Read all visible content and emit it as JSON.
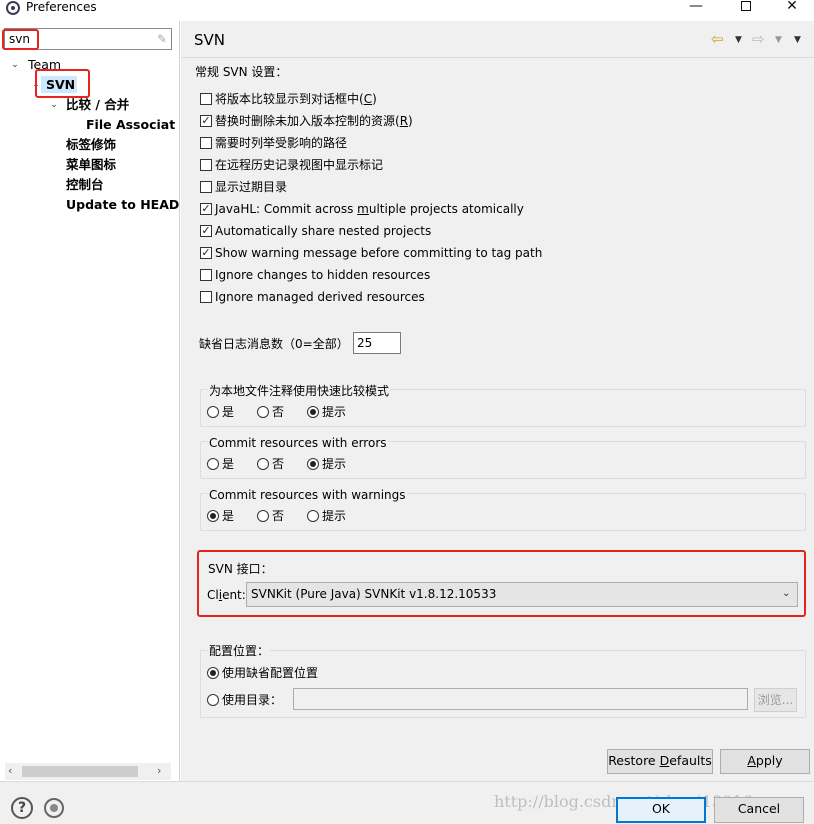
{
  "window": {
    "title": "Preferences",
    "minimize": "—",
    "close": "✕"
  },
  "filter": {
    "value": "svn",
    "clear_icon": "eraser-icon"
  },
  "tree": {
    "team": "Team",
    "svn": "SVN",
    "compare_merge": "比较 / 合并",
    "file_assoc": "File Associatio",
    "label_decorations": "标签修饰",
    "menu_icons": "菜单图标",
    "console": "控制台",
    "update_head": "Update to HEAD"
  },
  "header": {
    "title": "SVN",
    "back_icon": "back-arrow-icon",
    "forward_icon": "forward-arrow-icon"
  },
  "general": {
    "heading": "常规 SVN 设置：",
    "options": [
      {
        "label_a": "将版本比较显示到对话框中(",
        "key": "C",
        "label_b": ")",
        "checked": false
      },
      {
        "label_a": "替换时删除未加入版本控制的资源(",
        "key": "R",
        "label_b": ")",
        "checked": true
      },
      {
        "label_a": "需要时列举受影响的路径",
        "key": "",
        "label_b": "",
        "checked": false
      },
      {
        "label_a": "在远程历史记录视图中显示标记",
        "key": "",
        "label_b": "",
        "checked": false
      },
      {
        "label_a": "显示过期目录",
        "key": "",
        "label_b": "",
        "checked": false
      },
      {
        "label_a": "JavaHL: Commit across ",
        "key": "m",
        "label_b": "ultiple projects atomically",
        "checked": true
      },
      {
        "label_a": "Automatically share nested projects",
        "key": "",
        "label_b": "",
        "checked": true
      },
      {
        "label_a": "Show warning message before committing to tag path",
        "key": "",
        "label_b": "",
        "checked": true
      },
      {
        "label_a": "Ignore changes to hidden resources",
        "key": "",
        "label_b": "",
        "checked": false
      },
      {
        "label_a": "Ignore managed derived resources",
        "key": "",
        "label_b": "",
        "checked": false
      }
    ]
  },
  "history": {
    "label": "缺省日志消息数（0=全部）",
    "value": "25"
  },
  "groups": [
    {
      "title": "为本地文件注释使用快速比较模式",
      "options": [
        "是",
        "否",
        "提示"
      ],
      "selected": 2
    },
    {
      "title": "Commit resources with errors",
      "options": [
        "是",
        "否",
        "提示"
      ],
      "selected": 2
    },
    {
      "title": "Commit resources with warnings",
      "options": [
        "是",
        "否",
        "提示"
      ],
      "selected": 0
    }
  ],
  "svn_interface": {
    "title": "SVN 接口：",
    "client_label_a": "Cl",
    "client_label_key": "i",
    "client_label_b": "ent:",
    "client_value": "SVNKit (Pure Java) SVNKit v1.8.12.10533"
  },
  "config": {
    "title": "配置位置：",
    "default_option": "使用缺省配置位置",
    "dir_option": "使用目录：",
    "selected": 0,
    "dir_value": "",
    "browse": "浏览..."
  },
  "buttons": {
    "restore_a": "Restore ",
    "restore_key": "D",
    "restore_b": "efaults",
    "apply_key": "A",
    "apply_b": "pply",
    "ok": "OK",
    "cancel": "Cancel"
  },
  "watermark": "http://blog.csdn.net/shuai13016"
}
